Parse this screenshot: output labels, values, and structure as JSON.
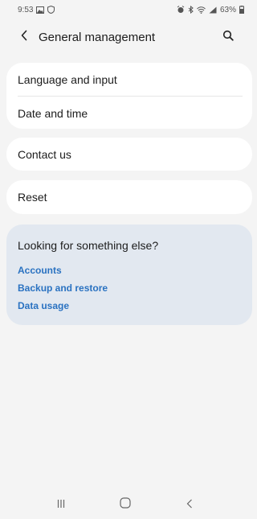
{
  "status_bar": {
    "time": "9:53",
    "battery": "63%",
    "icons": [
      "gallery-icon",
      "shield-icon",
      "alarm-icon",
      "bluetooth-icon",
      "wifi-icon",
      "signal-icon",
      "battery-icon"
    ]
  },
  "header": {
    "back_icon": "chevron-left-icon",
    "title": "General management",
    "search_icon": "search-icon"
  },
  "menu": {
    "language": "Language and input",
    "date_time": "Date and time",
    "contact": "Contact us",
    "reset": "Reset"
  },
  "suggestions": {
    "title": "Looking for something else?",
    "links": [
      "Accounts",
      "Backup and restore",
      "Data usage"
    ],
    "link_color": "#2a72c1"
  },
  "nav_bar": {
    "icons": [
      "recents-icon",
      "home-icon",
      "back-icon"
    ]
  },
  "colors": {
    "background": "#f4f4f4",
    "card": "#ffffff",
    "suggest_bg": "#e2e8f0"
  }
}
